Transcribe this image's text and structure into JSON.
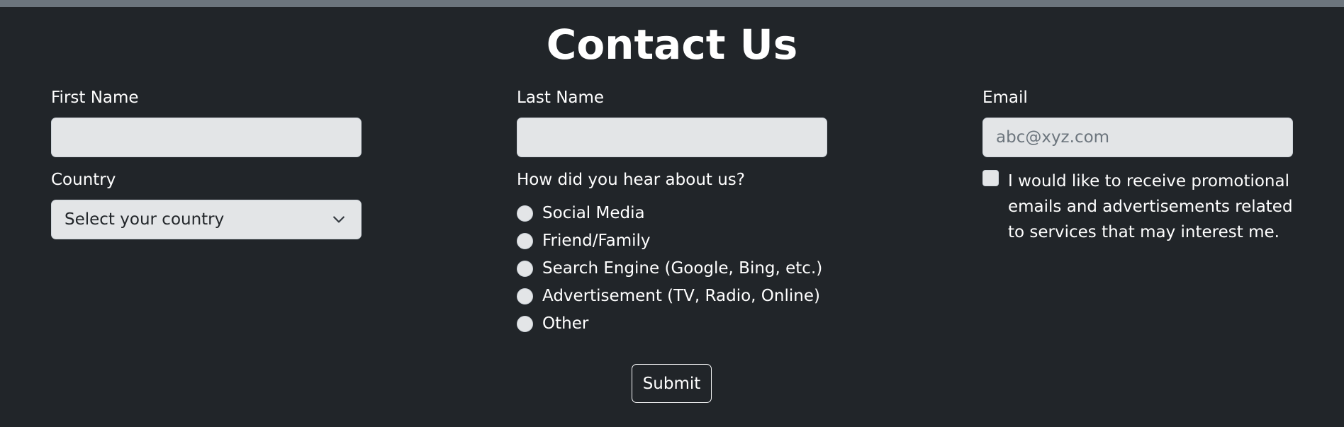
{
  "page": {
    "title": "Contact Us"
  },
  "form": {
    "first_name": {
      "label": "First Name",
      "value": "",
      "placeholder": ""
    },
    "last_name": {
      "label": "Last Name",
      "value": "",
      "placeholder": ""
    },
    "email": {
      "label": "Email",
      "value": "",
      "placeholder": "abc@xyz.com"
    },
    "country": {
      "label": "Country",
      "selected": "Select your country"
    },
    "referral": {
      "question": "How did you hear about us?",
      "options": [
        "Social Media",
        "Friend/Family",
        "Search Engine (Google, Bing, etc.)",
        "Advertisement (TV, Radio, Online)",
        "Other"
      ]
    },
    "consent": {
      "label": "I would like to receive promotional emails and advertisements related to services that may interest me.",
      "checked": false
    },
    "submit_label": "Submit"
  },
  "colors": {
    "background": "#212529",
    "top_bar": "#6c757d",
    "input_fill": "#e3e5e7",
    "text": "#ffffff"
  },
  "icons": {
    "country_select": "chevron-down-icon"
  }
}
